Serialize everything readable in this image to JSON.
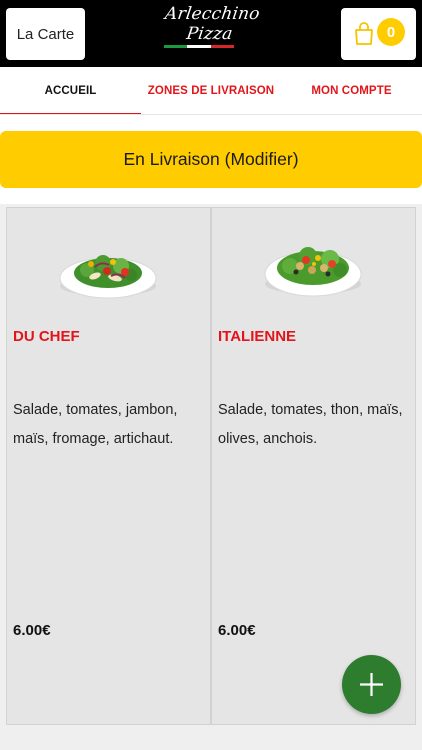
{
  "header": {
    "menu_button_label": "La Carte",
    "logo_text": "Arlecchino Pizza",
    "cart_count": "0",
    "colors": {
      "background": "#000000",
      "flag_green": "#1d9a3c",
      "flag_white": "#ffffff",
      "flag_red": "#d62828"
    }
  },
  "tabs": [
    {
      "label": "ACCUEIL",
      "active": true
    },
    {
      "label": "ZONES DE LIVRAISON",
      "active": false
    },
    {
      "label": "MON COMPTE",
      "active": false
    }
  ],
  "delivery_banner": {
    "label": "En Livraison (Modifier)",
    "color": "#ffcc00"
  },
  "products": [
    {
      "name": "DU CHEF",
      "description": "Salade, tomates, jambon, maïs, fromage, artichaut.",
      "price": "6.00€",
      "image": "salad-plate"
    },
    {
      "name": "ITALIENNE",
      "description": "Salade, tomates, thon, maïs, olives, anchois.",
      "price": "6.00€",
      "image": "salad-plate"
    }
  ],
  "fab": {
    "icon": "plus-icon",
    "color": "#2e7d2e"
  },
  "accent_color": "#e3151a"
}
